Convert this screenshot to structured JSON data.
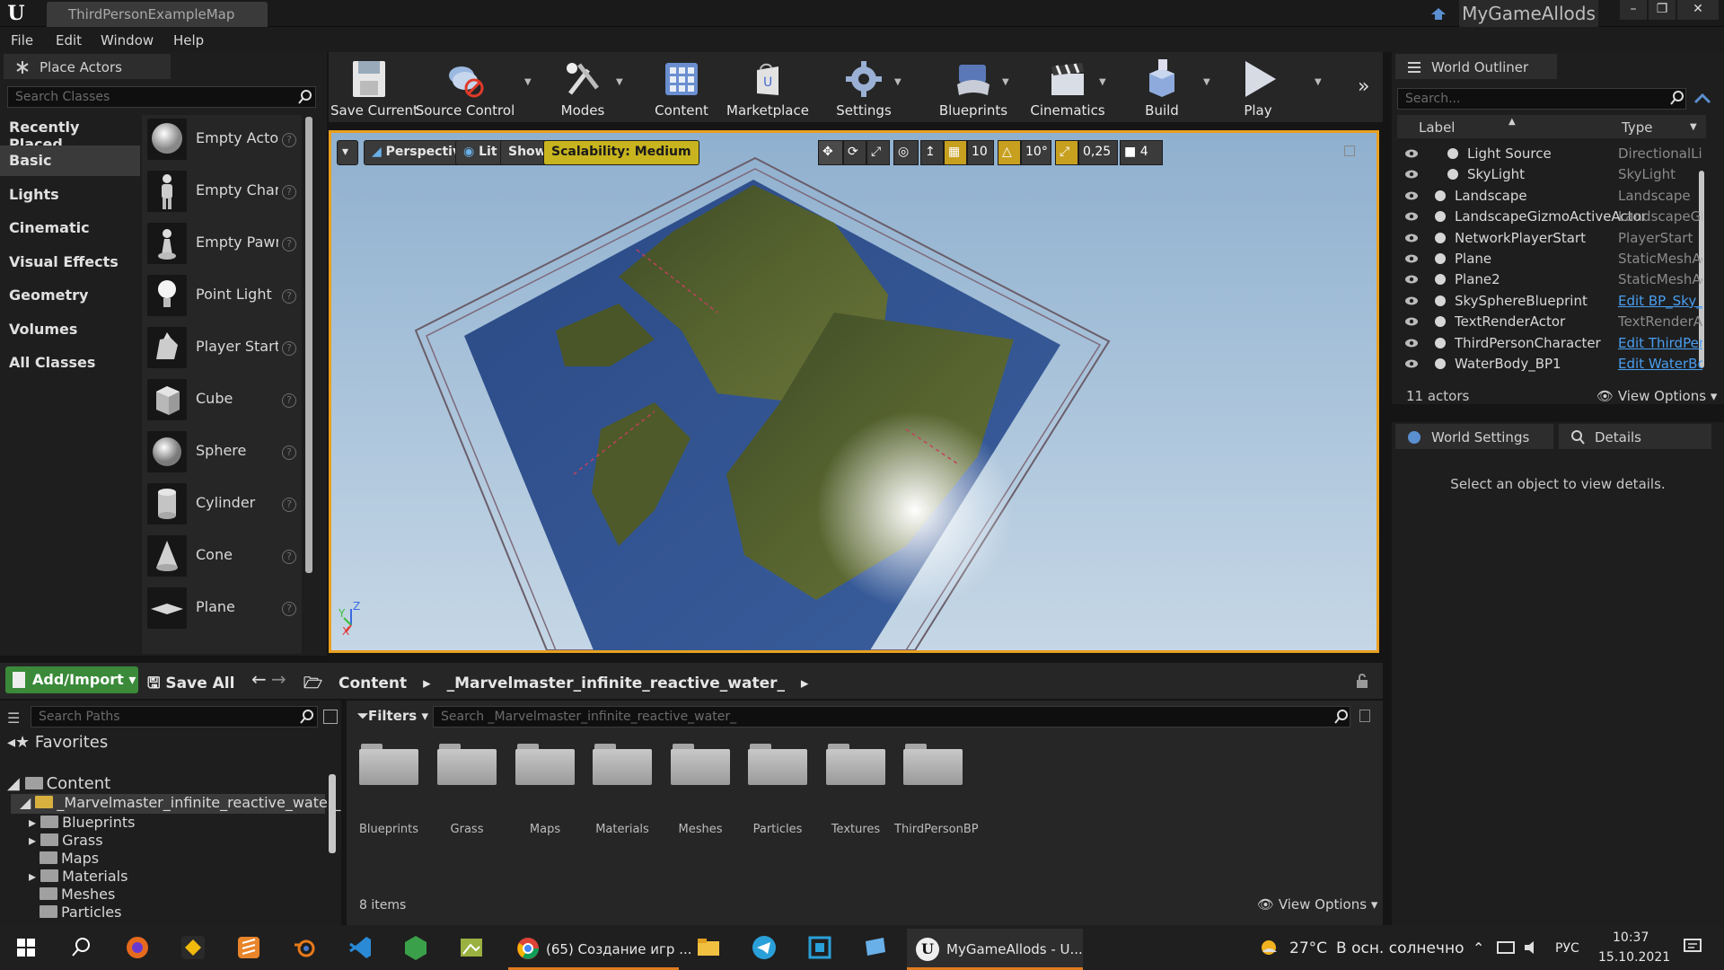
{
  "window": {
    "tab_title": "ThirdPersonExampleMap",
    "project_name": "MyGameAllods",
    "logo": "U"
  },
  "menu": [
    "File",
    "Edit",
    "Window",
    "Help"
  ],
  "place_actors": {
    "title": "Place Actors",
    "search_placeholder": "Search Classes",
    "categories": [
      "Recently Placed",
      "Basic",
      "Lights",
      "Cinematic",
      "Visual Effects",
      "Geometry",
      "Volumes",
      "All Classes"
    ],
    "selected_category": "Basic",
    "actors": [
      "Empty Actor",
      "Empty Character",
      "Empty Pawn",
      "Point Light",
      "Player Start",
      "Cube",
      "Sphere",
      "Cylinder",
      "Cone",
      "Plane"
    ]
  },
  "toolbar": [
    "Save Current",
    "Source Control",
    "Modes",
    "Content",
    "Marketplace",
    "Settings",
    "Blueprints",
    "Cinematics",
    "Build",
    "Play"
  ],
  "viewport": {
    "perspective": "Perspective",
    "lit": "Lit",
    "show": "Show",
    "scalability": "Scalability: Medium",
    "grid_snap": "10",
    "rotation_snap": "10°",
    "scale_snap": "0,25",
    "camera_speed": "4",
    "axis_y": "Y",
    "axis_z": "Z",
    "axis_x": "X"
  },
  "outliner": {
    "title": "World Outliner",
    "search_placeholder": "Search...",
    "col_label": "Label",
    "col_type": "Type",
    "rows": [
      {
        "label": "Light Source",
        "type": "DirectionalLight",
        "link": false
      },
      {
        "label": "SkyLight",
        "type": "SkyLight",
        "link": false
      },
      {
        "label": "Landscape",
        "type": "Landscape",
        "link": false
      },
      {
        "label": "LandscapeGizmoActiveActor",
        "type": "LandscapeGizmoActiveActor",
        "link": false
      },
      {
        "label": "NetworkPlayerStart",
        "type": "PlayerStart",
        "link": false
      },
      {
        "label": "Plane",
        "type": "StaticMeshActor",
        "link": false
      },
      {
        "label": "Plane2",
        "type": "StaticMeshActor",
        "link": false
      },
      {
        "label": "SkySphereBlueprint",
        "type": "Edit BP_Sky_Sphere",
        "link": true
      },
      {
        "label": "TextRenderActor",
        "type": "TextRenderActor",
        "link": false
      },
      {
        "label": "ThirdPersonCharacter",
        "type": "Edit ThirdPersonCharacter",
        "link": true
      },
      {
        "label": "WaterBody_BP1",
        "type": "Edit WaterBody_BP",
        "link": true
      }
    ],
    "count": "11 actors",
    "view_options": "View Options"
  },
  "details": {
    "tab_world": "World Settings",
    "tab_details": "Details",
    "empty": "Select an object to view details."
  },
  "content_browser": {
    "add_import": "Add/Import",
    "save_all": "Save All",
    "breadcrumb": [
      "Content",
      "_Marvelmaster_infinite_reactive_water_"
    ],
    "search_paths": "Search Paths",
    "favorites": "Favorites",
    "tree": [
      "Content",
      "_Marvelmaster_infinite_reactive_water_",
      "Blueprints",
      "Grass",
      "Maps",
      "Materials",
      "Meshes",
      "Particles"
    ],
    "filters": "Filters",
    "search_placeholder": "Search _Marvelmaster_infinite_reactive_water_",
    "folders": [
      "Blueprints",
      "Grass",
      "Maps",
      "Materials",
      "Meshes",
      "Particles",
      "Textures",
      "ThirdPersonBP"
    ],
    "item_count": "8 items",
    "view_options": "View Options"
  },
  "taskbar": {
    "chrome_task": "(65) Создание игр ...",
    "ue_task": "MyGameAllods - U...",
    "weather_temp": "27°C",
    "weather_text": "В осн. солнечно",
    "lang": "РУС",
    "time": "10:37",
    "date": "15.10.2021"
  },
  "colors": {
    "accent": "#e8a020",
    "link": "#4a9ef0",
    "add_green": "#3a8a3a",
    "scalability": "#c8b41e"
  }
}
